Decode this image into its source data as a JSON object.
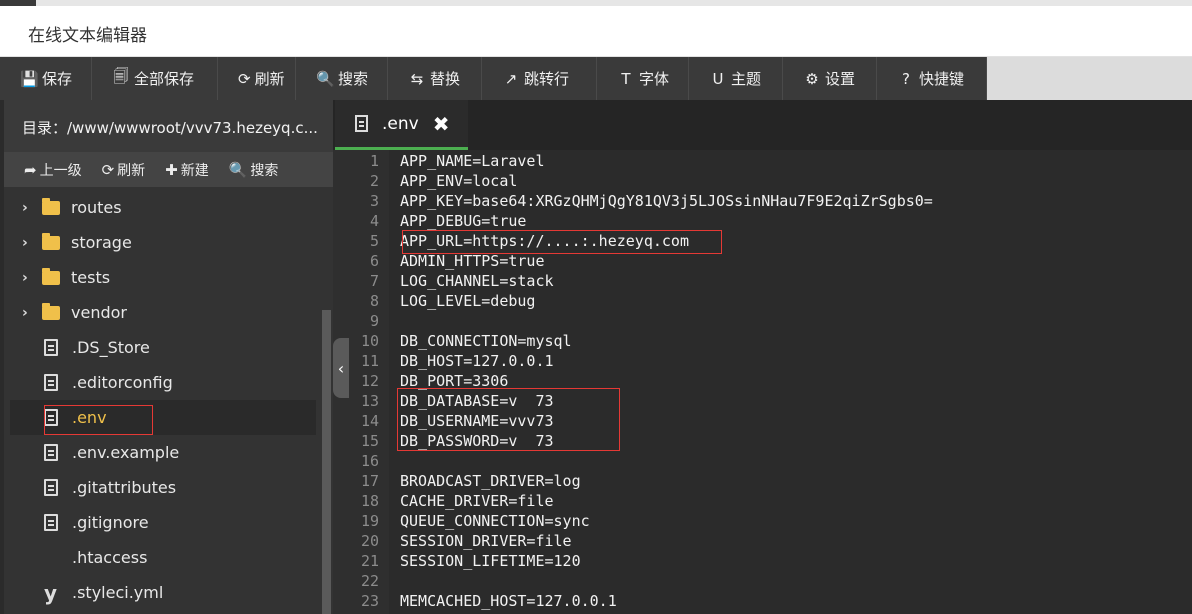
{
  "window": {
    "title": "在线文本编辑器"
  },
  "toolbar": [
    {
      "icon": "save-icon",
      "glyph": "💾",
      "label": "保存"
    },
    {
      "icon": "save-all-icon",
      "glyph": "🗐",
      "label": "全部保存"
    },
    {
      "icon": "refresh-icon",
      "glyph": "⟳",
      "label": "刷新"
    },
    {
      "icon": "search-icon",
      "glyph": "🔍",
      "label": "搜索"
    },
    {
      "icon": "replace-icon",
      "glyph": "⇆",
      "label": "替换"
    },
    {
      "icon": "goto-line-icon",
      "glyph": "↗",
      "label": "跳转行"
    },
    {
      "icon": "font-icon",
      "glyph": "T",
      "label": "字体"
    },
    {
      "icon": "theme-icon",
      "glyph": "U",
      "label": "主题"
    },
    {
      "icon": "settings-icon",
      "glyph": "⚙",
      "label": "设置"
    },
    {
      "icon": "shortcut-icon",
      "glyph": "?",
      "label": "快捷键"
    }
  ],
  "sidebar": {
    "path": "目录：/www/wwwroot/vvv73.hezeyq.c...",
    "tools": [
      {
        "icon": "up-level-icon",
        "glyph": "➦",
        "label": "上一级"
      },
      {
        "icon": "refresh-icon",
        "glyph": "⟳",
        "label": "刷新"
      },
      {
        "icon": "new-icon",
        "glyph": "✚",
        "label": "新建"
      },
      {
        "icon": "search-icon",
        "glyph": "🔍",
        "label": "搜索"
      }
    ],
    "files": [
      {
        "name": "routes",
        "type": "folder"
      },
      {
        "name": "storage",
        "type": "folder"
      },
      {
        "name": "tests",
        "type": "folder"
      },
      {
        "name": "vendor",
        "type": "folder"
      },
      {
        "name": ".DS_Store",
        "type": "file"
      },
      {
        "name": ".editorconfig",
        "type": "file"
      },
      {
        "name": ".env",
        "type": "file",
        "selected": true
      },
      {
        "name": ".env.example",
        "type": "file"
      },
      {
        "name": ".gitattributes",
        "type": "file"
      },
      {
        "name": ".gitignore",
        "type": "file"
      },
      {
        "name": ".htaccess",
        "type": "plain"
      },
      {
        "name": ".styleci.yml",
        "type": "yml"
      }
    ]
  },
  "tab": {
    "label": ".env",
    "close": "✖"
  },
  "collapse_glyph": "‹",
  "editor": {
    "lines": [
      "APP_NAME=Laravel",
      "APP_ENV=local",
      "APP_KEY=base64:XRGzQHMjQgY81QV3j5LJOSsinNHau7F9E2qiZrSgbs0=",
      "APP_DEBUG=true",
      "APP_URL=https://....:.hezeyq.com",
      "ADMIN_HTTPS=true",
      "LOG_CHANNEL=stack",
      "LOG_LEVEL=debug",
      "",
      "DB_CONNECTION=mysql",
      "DB_HOST=127.0.0.1",
      "DB_PORT=3306",
      "DB_DATABASE=v  73",
      "DB_USERNAME=vvv73",
      "DB_PASSWORD=v  73",
      "",
      "BROADCAST_DRIVER=log",
      "CACHE_DRIVER=file",
      "QUEUE_CONNECTION=sync",
      "SESSION_DRIVER=file",
      "SESSION_LIFETIME=120",
      "",
      "MEMCACHED_HOST=127.0.0.1"
    ]
  },
  "colors": {
    "selected_file": "#f0c04a",
    "tab_active_underline": "#4caf50",
    "highlight_box": "#e53935"
  }
}
